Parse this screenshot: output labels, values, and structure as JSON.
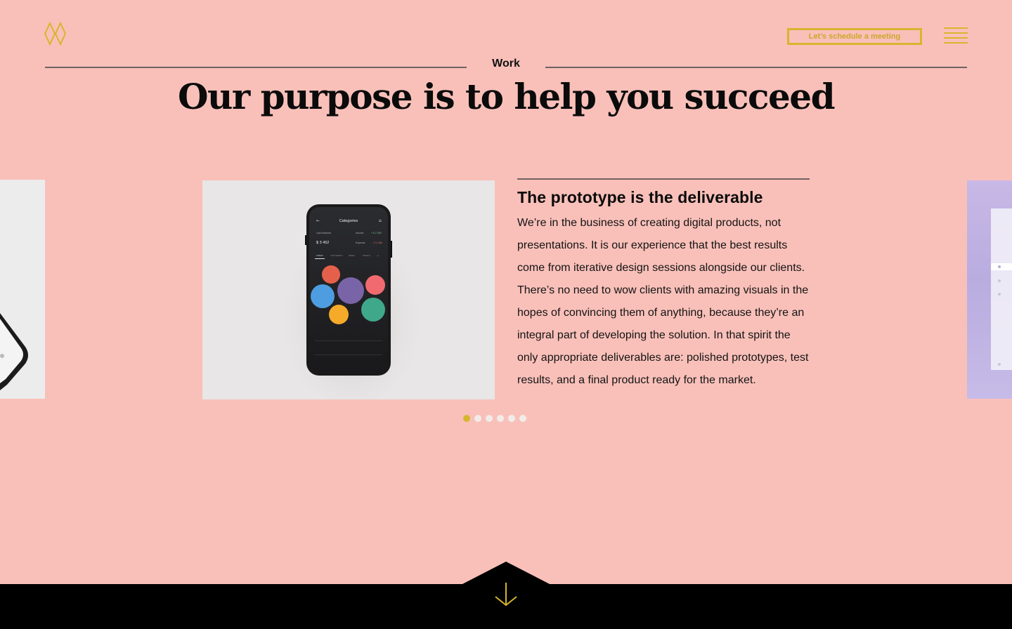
{
  "header": {
    "logo": "diamond-logo",
    "cta_label": "Let’s schedule a meeting",
    "menu_icon": "hamburger-icon"
  },
  "section": {
    "label": "Work",
    "headline": "Our purpose is to help you succeed"
  },
  "slide": {
    "title": "The prototype is the deliverable",
    "body": "We’re in the business of creating digital products, not presentations. It is our experience that the best results come from iterative design sessions alongside our clients. There’s no need to wow clients with amazing visuals in the hopes of convincing them of anything, because they’re an integral part of developing the solution. In that spirit the only appropriate deliverables are: polished prototypes, test results, and a final product ready for the market."
  },
  "phone": {
    "title": "Categories",
    "card_label": "Card Balance",
    "balance": "$ 3 452",
    "income_label": "Income",
    "income_value": "+ 6 2 300",
    "expense_label": "Expense",
    "expense_value": "- 2 1 442",
    "tabs": [
      "TODAY",
      "YESTERDAY",
      "WEEK",
      "MONTH",
      "•••"
    ]
  },
  "carousel": {
    "count": 6,
    "active_index": 0
  },
  "colors": {
    "background": "#f9c0b9",
    "accent": "#d6b52f",
    "footer": "#000000"
  },
  "footer": {
    "scroll_icon": "arrow-down-icon"
  }
}
